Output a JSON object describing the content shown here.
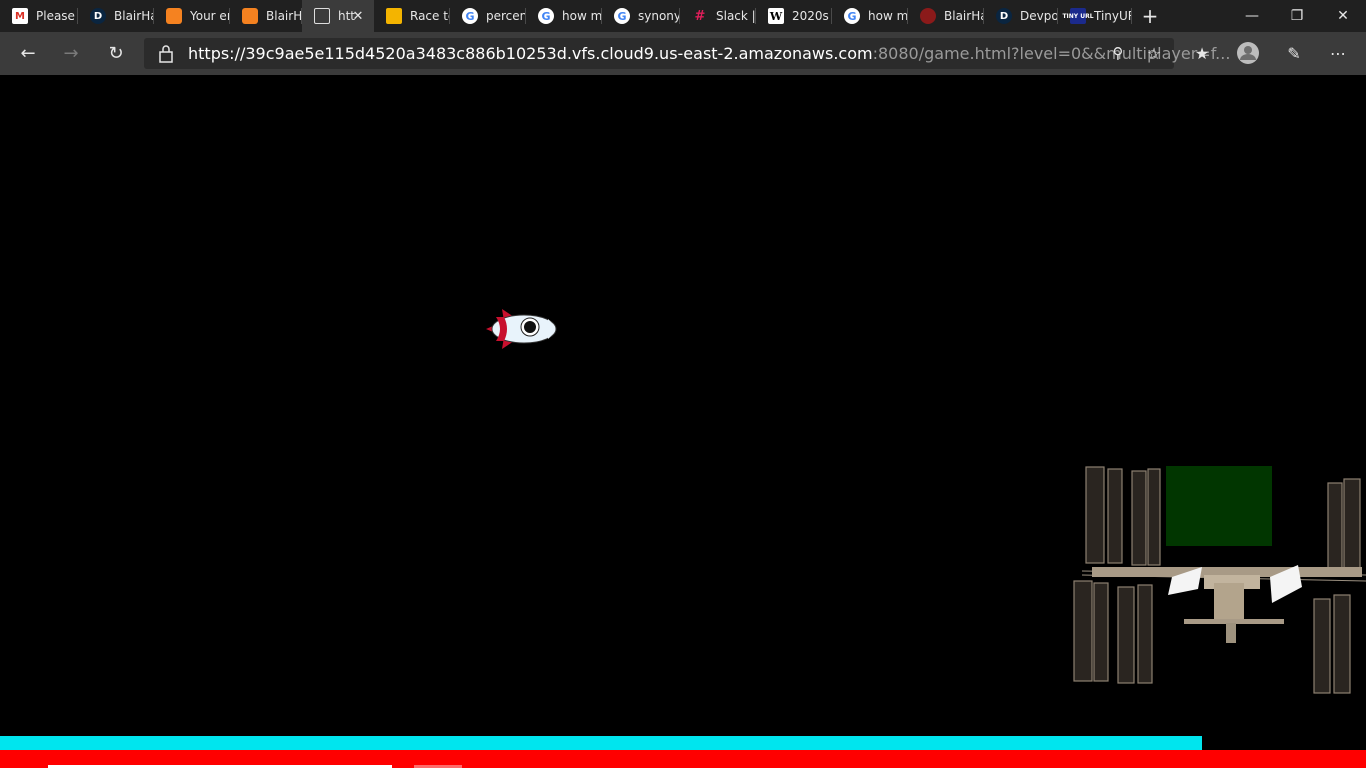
{
  "tabs": [
    {
      "label": "Please",
      "icon": "gmail-icon",
      "glyph": "M"
    },
    {
      "label": "BlairHa",
      "icon": "devpost-icon",
      "glyph": "D"
    },
    {
      "label": "Your er",
      "icon": "cube-icon",
      "glyph": ""
    },
    {
      "label": "BlairHa",
      "icon": "cube-icon",
      "glyph": ""
    },
    {
      "label": "htt",
      "icon": "page-icon",
      "glyph": "",
      "active": true
    },
    {
      "label": "Race tc",
      "icon": "slides-icon",
      "glyph": ""
    },
    {
      "label": "percent",
      "icon": "google-icon",
      "glyph": "G"
    },
    {
      "label": "how m",
      "icon": "google-icon",
      "glyph": "G"
    },
    {
      "label": "synony",
      "icon": "google-icon",
      "glyph": "G"
    },
    {
      "label": "Slack |",
      "icon": "slack-icon",
      "glyph": "#"
    },
    {
      "label": "2020s i",
      "icon": "wikipedia-icon",
      "glyph": "W"
    },
    {
      "label": "how m",
      "icon": "google-icon",
      "glyph": "G"
    },
    {
      "label": "BlairHa",
      "icon": "bug-icon",
      "glyph": ""
    },
    {
      "label": "Devpos",
      "icon": "devpost-icon",
      "glyph": "D"
    },
    {
      "label": "TinyUR",
      "icon": "tinyurl-icon",
      "glyph": "TINY URL"
    }
  ],
  "address": {
    "host": "https://39c9ae5e115d4520a3483c886b10253d.vfs.cloud9.us-east-2.amazonaws.com",
    "rest": ":8080/game.html?level=0&&multiplayer=f..."
  },
  "game": {
    "fuel_fraction": 0.88,
    "colors": {
      "fuel": "#00e5ee",
      "health": "#ff0000",
      "panel": "#013600"
    }
  }
}
